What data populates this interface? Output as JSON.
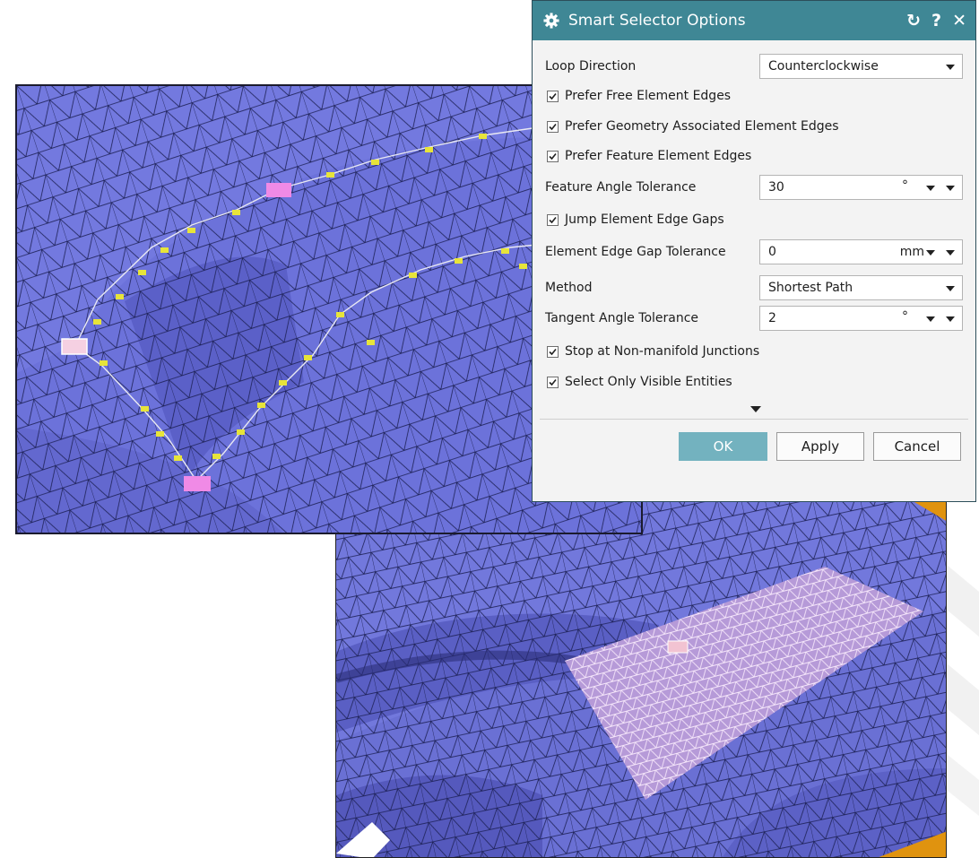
{
  "dialog": {
    "title": "Smart Selector Options",
    "title_icons": [
      "gear-icon"
    ],
    "title_buttons": [
      {
        "name": "reset-icon",
        "glyph": "↻"
      },
      {
        "name": "help-icon",
        "glyph": "?"
      },
      {
        "name": "close-icon",
        "glyph": "✕"
      }
    ],
    "loop_direction": {
      "label": "Loop Direction",
      "value": "Counterclockwise"
    },
    "prefer_free": {
      "label": "Prefer Free Element Edges",
      "checked": true
    },
    "prefer_geometry": {
      "label": "Prefer Geometry Associated Element Edges",
      "checked": true
    },
    "prefer_feature": {
      "label": "Prefer Feature Element Edges",
      "checked": true
    },
    "feature_angle": {
      "label": "Feature Angle Tolerance",
      "value": "30",
      "unit": "°"
    },
    "jump_gaps": {
      "label": "Jump Element Edge Gaps",
      "checked": true
    },
    "edge_gap": {
      "label": "Element Edge Gap Tolerance",
      "value": "0",
      "unit": "mm"
    },
    "method": {
      "label": "Method",
      "value": "Shortest Path"
    },
    "tangent_angle": {
      "label": "Tangent Angle Tolerance",
      "value": "2",
      "unit": "°"
    },
    "stop_nonmanifold": {
      "label": "Stop at Non-manifold Junctions",
      "checked": true
    },
    "visible_only": {
      "label": "Select Only Visible Entities",
      "checked": true
    },
    "buttons": {
      "ok": "OK",
      "apply": "Apply",
      "cancel": "Cancel"
    }
  },
  "colors": {
    "title_bar": "#3f8795",
    "ok_button": "#73b2bf",
    "mesh_face": "#6b71d8",
    "mesh_edge": "#1d2156",
    "selected_node": "#f08ae6",
    "path_marker": "#e7e43a",
    "orange_part": "#e0930f"
  }
}
